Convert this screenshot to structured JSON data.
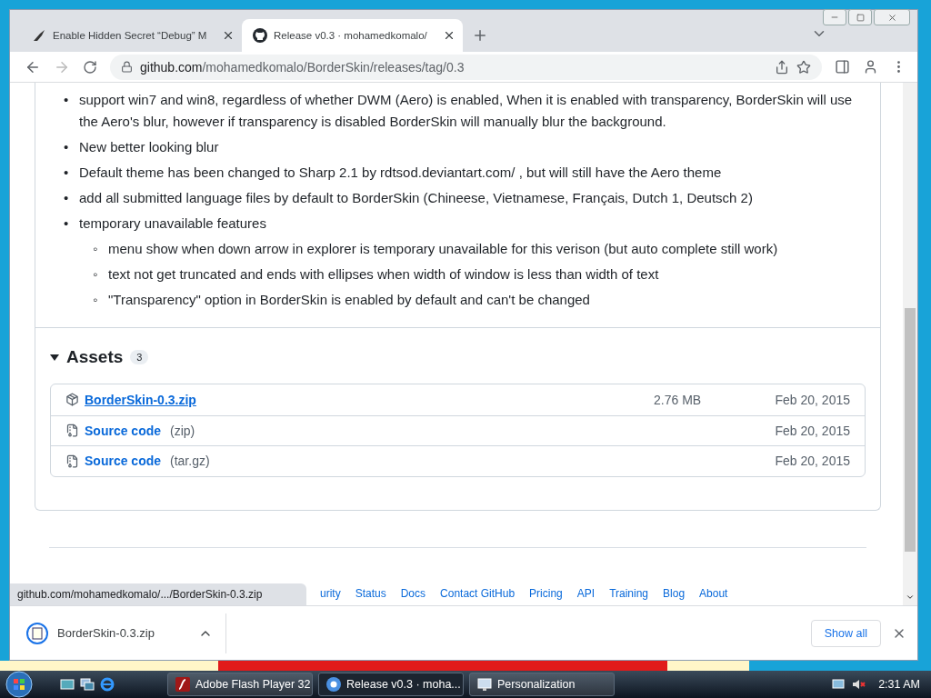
{
  "browser": {
    "tabs": [
      {
        "title": "Enable Hidden Secret “Debug” M",
        "selected": false,
        "kind": "blog"
      },
      {
        "title": "Release v0.3 · mohamedkomalo/",
        "selected": true,
        "kind": "github"
      }
    ],
    "address": {
      "domain": "github.com",
      "path": "/mohamedkomalo/BorderSkin/releases/tag/0.3"
    }
  },
  "notes": [
    {
      "marker": "•",
      "text": "support win7 and win8, regardless of whether DWM (Aero) is enabled, When it is enabled with transparency, BorderSkin will use the Aero's blur, however if transparency is disabled BorderSkin will manually blur the background."
    },
    {
      "marker": "•",
      "text": "New better looking blur"
    },
    {
      "marker": "•",
      "text": "Default theme has been changed to Sharp 2.1 by rdtsod.deviantart.com/ , but will still have the Aero theme"
    },
    {
      "marker": "•",
      "text": "add all submitted language files by default to BorderSkin (Chineese, Vietnamese, Français, Dutch 1, Deutsch 2)"
    },
    {
      "marker": "•",
      "text": "temporary unavailable features",
      "children": [
        {
          "marker": "◦",
          "text": "menu show when down arrow in explorer is temporary unavailable for this verison (but auto complete still work)"
        },
        {
          "marker": "◦",
          "text": "text not get truncated and ends with ellipses when width of window is less than width of text"
        },
        {
          "marker": "◦",
          "text": "\"Transparency\" option in BorderSkin is enabled by default and can't be changed"
        }
      ]
    }
  ],
  "assets": {
    "title": "Assets",
    "count": "3",
    "expanded": true,
    "items": [
      {
        "kind": "package",
        "name": "BorderSkin-0.3.zip",
        "size": "2.76 MB",
        "date": "Feb 20, 2015",
        "hovered": true
      },
      {
        "kind": "source",
        "name": "Source code",
        "suffix": "(zip)",
        "date": "Feb 20, 2015",
        "hovered": false
      },
      {
        "kind": "source",
        "name": "Source code",
        "suffix": "(tar.gz)",
        "date": "Feb 20, 2015",
        "hovered": false
      }
    ]
  },
  "footer_links": [
    "urity",
    "Status",
    "Docs",
    "Contact GitHub",
    "Pricing",
    "API",
    "Training",
    "Blog",
    "About"
  ],
  "status_bubble": "github.com/mohamedkomalo/.../BorderSkin-0.3.zip",
  "download_bar": {
    "filename": "BorderSkin-0.3.zip",
    "show_all": "Show all"
  },
  "taskbar": {
    "tasks": [
      {
        "label": "Adobe Flash Player 32",
        "selected": false,
        "kind": "flash"
      },
      {
        "label": "Release v0.3 · moha...",
        "selected": true,
        "kind": "chrome"
      },
      {
        "label": "Personalization",
        "selected": false,
        "kind": "monitor"
      }
    ],
    "clock": "2:31 AM"
  }
}
